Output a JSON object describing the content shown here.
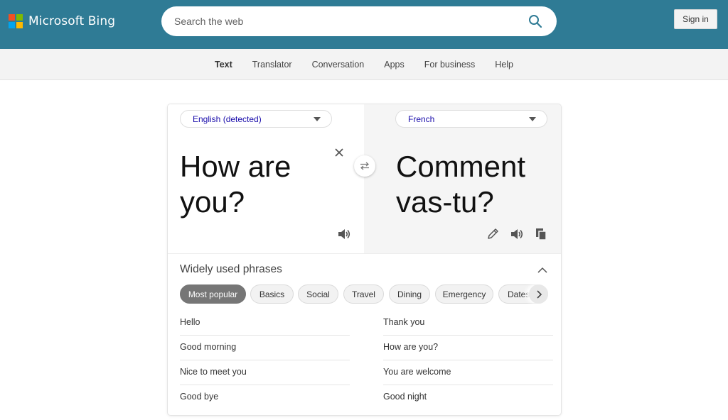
{
  "header": {
    "brand": "Microsoft Bing",
    "logo_colors": [
      "#f25022",
      "#7fba00",
      "#00a4ef",
      "#ffb900"
    ],
    "search_placeholder": "Search the web",
    "sign_in_label": "Sign in"
  },
  "subnav": {
    "items": [
      {
        "label": "Text",
        "active": true
      },
      {
        "label": "Translator"
      },
      {
        "label": "Conversation"
      },
      {
        "label": "Apps"
      },
      {
        "label": "For business"
      },
      {
        "label": "Help"
      }
    ]
  },
  "translator": {
    "source_language": "English (detected)",
    "target_language": "French",
    "source_text": "How are you?",
    "translated_text": "Comment vas-tu?",
    "icons": [
      "clear-icon",
      "swap-icon",
      "speaker-icon",
      "edit-icon",
      "copy-icon"
    ]
  },
  "phrases": {
    "title": "Widely used phrases",
    "categories": [
      "Most popular",
      "Basics",
      "Social",
      "Travel",
      "Dining",
      "Emergency",
      "Dates"
    ],
    "active_category": "Most popular",
    "left": [
      "Hello",
      "Good morning",
      "Nice to meet you",
      "Good bye"
    ],
    "right": [
      "Thank you",
      "How are you?",
      "You are welcome",
      "Good night"
    ]
  }
}
